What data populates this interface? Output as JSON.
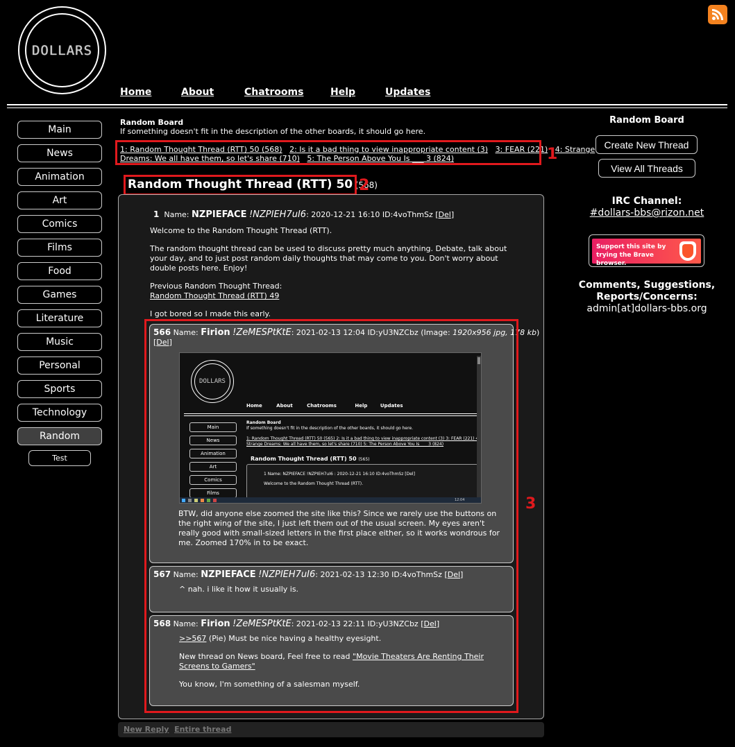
{
  "logo_text": "DOLLARS",
  "nav": [
    "Home",
    "About",
    "Chatrooms",
    "Help",
    "Updates"
  ],
  "sidebar": [
    "Main",
    "News",
    "Animation",
    "Art",
    "Comics",
    "Films",
    "Food",
    "Games",
    "Literature",
    "Music",
    "Personal",
    "Sports",
    "Technology",
    "Random",
    "Test"
  ],
  "board": {
    "title": "Random Board",
    "desc": "If something doesn't fit in the description of the other boards, it should go here."
  },
  "thread_links": {
    "l1": "1: Random Thought Thread (RTT) 50 (568)",
    "l2": "2: Is it a bad thing to view inappropriate content (3)",
    "l3": "3: FEAR (221)",
    "l4a": "4: Strange",
    "l4b": "Dreams: We all have them, so let's share (710)",
    "l5": "5: The Person Above You Is ___ 3 (824)"
  },
  "thread": {
    "title": "Random Thought Thread (RTT) 50",
    "count": "(568)"
  },
  "annotations": {
    "a1": "1",
    "a2": "2",
    "a3": "3"
  },
  "op": {
    "num": "1",
    "name_label": "Name:",
    "name": "NZPIEFACE",
    "trip": "!NZPIEH7uI6",
    "meta": ": 2020-12-21 16:10 ID:4voThmSz",
    "del": "Del",
    "p1": "Welcome to the Random Thought Thread (RTT).",
    "p2": "The random thought thread can be used to discuss pretty much anything. Debate, talk about your day, and to just post random daily thoughts that may come to you. Don't worry about double posts here. Enjoy!",
    "p3": "Previous Random Thought Thread:",
    "p3link": "Random Thought Thread (RTT) 49",
    "p4": "I got bored so I made this early."
  },
  "r566": {
    "num": "566",
    "name_label": "Name:",
    "name": "Firion",
    "trip": "!ZeMESPtKtE",
    "meta": ": 2021-02-13 12:04 ID:yU3NZCbz (Image: ",
    "imginfo": "1920x956 jpg, 178 kb",
    "metaend": ")",
    "del": "Del",
    "body": "BTW, did anyone else zoomed the site like this? Since we rarely use the buttons on the right wing of the site, I just left them out of the usual screen. My eyes aren't really good with small-sized letters in the first place either, so it works wondrous for me. Zoomed 170% in to be exact."
  },
  "r567": {
    "num": "567",
    "name_label": "Name:",
    "name": "NZPIEFACE",
    "trip": "!NZPIEH7uI6",
    "meta": ": 2021-02-13 12:30 ID:4voThmSz",
    "del": "Del",
    "body": "^ nah. i like it how it usually is."
  },
  "r568": {
    "num": "568",
    "name_label": "Name:",
    "name": "Firion",
    "trip": "!ZeMESPtKtE",
    "meta": ": 2021-02-13 22:11 ID:yU3NZCbz",
    "del": "Del",
    "quote": ">>567",
    "b1": " (Pie) Must be nice having a healthy eyesight.",
    "b2": "New thread on News board, Feel free to read ",
    "b2link": "\"Movie Theaters Are Renting Their Screens to Gamers\"",
    "b3": "You know, I'm something of a salesman myself."
  },
  "footer": {
    "reply": "New Reply",
    "entire": "Entire thread"
  },
  "right": {
    "title": "Random Board",
    "create": "Create New Thread",
    "view": "View All Threads",
    "irc_label": "IRC Channel:",
    "irc": "#dollars-bbs@rizon.net",
    "brave": "Support this site by trying the Brave browser.",
    "comments": "Comments, Suggestions, Reports/Concerns:",
    "email": "admin[at]dollars-bbs.org"
  },
  "shot": {
    "nav": [
      "Home",
      "About",
      "Chatrooms",
      "Help",
      "Updates"
    ],
    "side": [
      "Main",
      "News",
      "Animation",
      "Art",
      "Comics",
      "Films"
    ],
    "board": "Random Board",
    "desc": "If something doesn't fit in the description of the other boards, it should go here.",
    "links1": "1: Random Thought Thread (RTT) 50 (565)  2: Is it a bad thing to view inappropriate content (3)  3: FEAR (221)  4:",
    "links2": "Strange Dreams: We all have them, so let's share (710)  5: The Person Above You Is ___ 3 (824)",
    "title": "Random Thought Thread (RTT) 50",
    "count": "(565)",
    "post": "1  Name: NZPIEFACE !NZPIEH7uI6 : 2020-12-21 16:10 ID:4voThmSz [Del]",
    "welcome": "Welcome to the Random Thought Thread (RTT).",
    "logo": "DOLLARS",
    "time": "12:04"
  },
  "colors": {
    "annotation": "#e0191d",
    "rss": "#f4821f",
    "brave": "#e91e63"
  }
}
